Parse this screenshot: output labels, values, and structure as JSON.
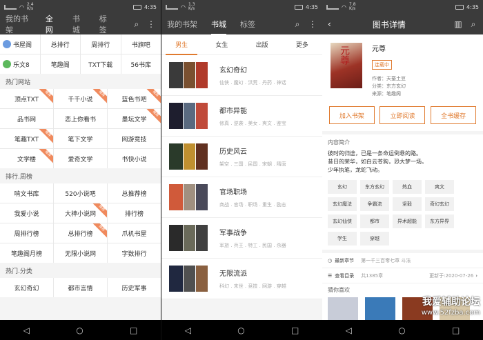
{
  "status": [
    {
      "speed": "2.4\nK/s",
      "time": "4:35"
    },
    {
      "speed": "1.3\nK/s",
      "time": "4:35"
    },
    {
      "speed": "7.8\nK/s",
      "time": "4:35"
    }
  ],
  "p1": {
    "tabs": [
      "我的书架",
      "全网",
      "书城",
      "标签"
    ],
    "sources": [
      {
        "name": "书屋阁",
        "color": "#6b9be0"
      },
      {
        "name": "总排行"
      },
      {
        "name": "周排行"
      },
      {
        "name": "书旗吧"
      },
      {
        "name": "乐文8",
        "color": "#5cb85c"
      },
      {
        "name": "笔趣阁"
      },
      {
        "name": "TXT下载"
      },
      {
        "name": "56书库"
      }
    ],
    "sections": [
      {
        "title": "热门网站",
        "items": [
          {
            "label": "顶点TXT",
            "rib": "推荐"
          },
          {
            "label": "千千小说",
            "rib": "推荐"
          },
          {
            "label": "蓝色书吧",
            "rib": "推荐"
          },
          {
            "label": "品书网"
          },
          {
            "label": "恋上你看书"
          },
          {
            "label": "墨坛文学",
            "rib": "推荐"
          },
          {
            "label": "笔趣TXT",
            "rib": "推荐"
          },
          {
            "label": "笔下文学"
          },
          {
            "label": "网游竞技"
          },
          {
            "label": "文学楼",
            "rib": "推荐"
          },
          {
            "label": "爱奇文学"
          },
          {
            "label": "书快小说"
          }
        ]
      },
      {
        "title": "排行.周榜",
        "items": [
          {
            "label": "啃文书库"
          },
          {
            "label": "520小说吧"
          },
          {
            "label": "总推荐榜"
          },
          {
            "label": "我爱小说"
          },
          {
            "label": "大神小说网",
            "rib": "推荐"
          },
          {
            "label": "排行榜"
          },
          {
            "label": "周排行榜"
          },
          {
            "label": "总排行榜",
            "rib": "推荐"
          },
          {
            "label": "爪机书屋"
          },
          {
            "label": "笔趣阁月榜"
          },
          {
            "label": "无限小说网"
          },
          {
            "label": "字数排行"
          }
        ]
      },
      {
        "title": "热门.分类",
        "items": [
          {
            "label": "玄幻奇幻"
          },
          {
            "label": "都市言情"
          },
          {
            "label": "历史军事"
          }
        ]
      }
    ]
  },
  "p2": {
    "tabs": [
      "我的书架",
      "书城",
      "标签"
    ],
    "subtabs": [
      "男生",
      "女生",
      "出版",
      "更多"
    ],
    "categories": [
      {
        "title": "玄幻奇幻",
        "sub": "仙侠 . 魔幻 . 洪荒 . 丹药 . 神话",
        "colors": [
          "#3a3a3a",
          "#7a5030",
          "#b03a2a"
        ]
      },
      {
        "title": "都市异能",
        "sub": "修真 . 逆袭 . 美女 . 爽文 . 鉴宝",
        "colors": [
          "#1e1e2e",
          "#5a6a80",
          "#c04a3a"
        ]
      },
      {
        "title": "历史风云",
        "sub": "架空 . 三国 . 民国 . 宋朝 . 隋唐",
        "colors": [
          "#2a3a2a",
          "#c09030",
          "#603020"
        ]
      },
      {
        "title": "官场职场",
        "sub": "商战 . 官场 . 职场 . 重生 . 励志",
        "colors": [
          "#d05a3a",
          "#a09080",
          "#4a4a5a"
        ]
      },
      {
        "title": "军事战争",
        "sub": "军旅 . 兵王 . 特工 . 民国 . 杀器",
        "colors": [
          "#2a2a2a",
          "#6a6a5a",
          "#404040"
        ]
      },
      {
        "title": "无限流派",
        "sub": "科幻 . 末世 . 竞技 . 网游 . 穿越",
        "colors": [
          "#202840",
          "#505050",
          "#8a6040"
        ]
      }
    ]
  },
  "p3": {
    "title": "图书详情",
    "book": {
      "name": "元尊",
      "status": "连载中",
      "author": "作者：天蚕土豆",
      "category": "分类：东方玄幻",
      "source": "来源：笔趣阁",
      "cover_text": "元尊"
    },
    "buttons": [
      "加入书架",
      "立即阅读",
      "全书缓存"
    ],
    "intro_title": "内容简介",
    "intro": "彼时的归途，已是一条命运倒悬的路。\n昔日的荣华，如白云苍狗，恐大梦一场。\n少年执笔，龙蛇飞动。",
    "tags": [
      "玄幻",
      "东方玄幻",
      "热血",
      "爽文",
      "玄幻魔法",
      "争霸流",
      "坚毅",
      "奇幻玄幻",
      "玄幻仙侠",
      "都市",
      "异术超能",
      "东方异界",
      "学生",
      "穿越"
    ],
    "latest": {
      "label": "最新章节",
      "value": "第一千三百零七章 斗法"
    },
    "toc": {
      "label": "查看目录",
      "count": "共1385章",
      "update": "更新于:2020-07-26"
    },
    "likes_title": "猜你喜欢",
    "watermark": {
      "line1": "我爱辅助论坛",
      "line2": "www.52fzba.com"
    }
  }
}
